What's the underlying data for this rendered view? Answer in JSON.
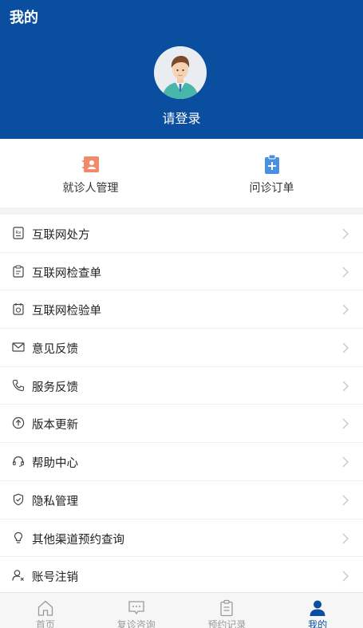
{
  "header": {
    "title": "我的",
    "login_text": "请登录"
  },
  "quick_actions": [
    {
      "label": "就诊人管理",
      "icon": "patient-card-icon",
      "color": "#f08a6a"
    },
    {
      "label": "问诊订单",
      "icon": "clipboard-plus-icon",
      "color": "#4a90e2"
    }
  ],
  "menu": [
    {
      "label": "互联网处方",
      "icon": "prescription-icon"
    },
    {
      "label": "互联网检查单",
      "icon": "exam-form-icon"
    },
    {
      "label": "互联网检验单",
      "icon": "lab-test-icon"
    },
    {
      "label": "意见反馈",
      "icon": "mail-icon"
    },
    {
      "label": "服务反馈",
      "icon": "phone-icon"
    },
    {
      "label": "版本更新",
      "icon": "upload-arrow-icon"
    },
    {
      "label": "帮助中心",
      "icon": "headset-icon"
    },
    {
      "label": "隐私管理",
      "icon": "shield-check-icon"
    },
    {
      "label": "其他渠道预约查询",
      "icon": "lightbulb-icon"
    },
    {
      "label": "账号注销",
      "icon": "user-remove-icon"
    }
  ],
  "tabbar": [
    {
      "label": "首页",
      "icon": "home-icon",
      "active": false
    },
    {
      "label": "复诊咨询",
      "icon": "chat-icon",
      "active": false
    },
    {
      "label": "预约记录",
      "icon": "record-icon",
      "active": false
    },
    {
      "label": "我的",
      "icon": "person-icon",
      "active": true
    }
  ],
  "colors": {
    "primary": "#0a4f9f",
    "background": "#f2f3f5"
  }
}
